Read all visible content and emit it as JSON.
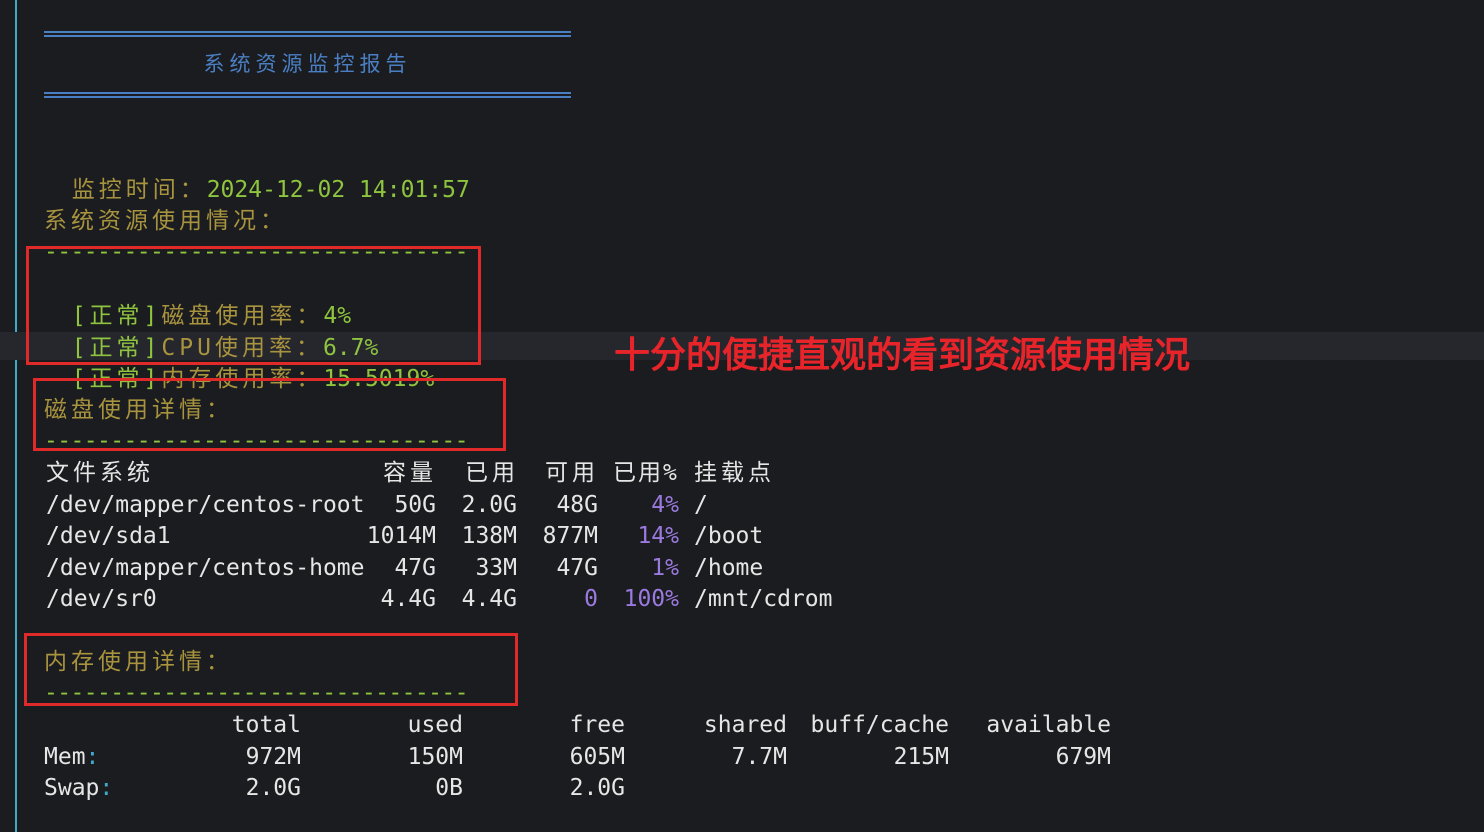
{
  "report": {
    "title": "系统资源监控报告",
    "monitor_time_label": "监控时间：",
    "monitor_time_value": "2024-12-02 14:01:57",
    "resource_usage_label": "系统资源使用情况：",
    "dashes": "--------------------------------",
    "status_lines": [
      {
        "tag": "[正常]",
        "label": "磁盘使用率：",
        "value": "4%"
      },
      {
        "tag": "[正常]",
        "label": "CPU使用率：",
        "value": "6.7%"
      },
      {
        "tag": "[正常]",
        "label": "内存使用率：",
        "value": "15.5019%"
      }
    ],
    "disk_detail_label": "磁盘使用详情：",
    "disk_headers": [
      "文件系统",
      "容量",
      "已用",
      "可用",
      "已用%",
      "挂载点"
    ],
    "disk_rows": [
      [
        "/dev/mapper/centos-root",
        "50G",
        "2.0G",
        "48G",
        "4%",
        "/"
      ],
      [
        "/dev/sda1",
        "1014M",
        "138M",
        "877M",
        "14%",
        "/boot"
      ],
      [
        "/dev/mapper/centos-home",
        "47G",
        "33M",
        "47G",
        "1%",
        "/home"
      ],
      [
        "/dev/sr0",
        "4.4G",
        "4.4G",
        "0",
        "100%",
        "/mnt/cdrom"
      ]
    ],
    "mem_detail_label": "内存使用详情：",
    "mem_headers": [
      "total",
      "used",
      "free",
      "shared",
      "buff/cache",
      "available"
    ],
    "mem_rows": [
      {
        "name": "Mem",
        "colon": ":",
        "values": [
          "972M",
          "150M",
          "605M",
          "7.7M",
          "215M",
          "679M"
        ]
      },
      {
        "name": "Swap",
        "colon": ":",
        "values": [
          "2.0G",
          "0B",
          "2.0G",
          "",
          "",
          ""
        ]
      }
    ]
  },
  "annotation": "十分的便捷直观的看到资源使用情况",
  "colors": {
    "label": "#a8933e",
    "value": "#8ec43e",
    "percent": "#9b7ae0",
    "rule": "#4a7fc3",
    "highlight_box": "#e02a2a",
    "annotation": "#e8242b"
  }
}
